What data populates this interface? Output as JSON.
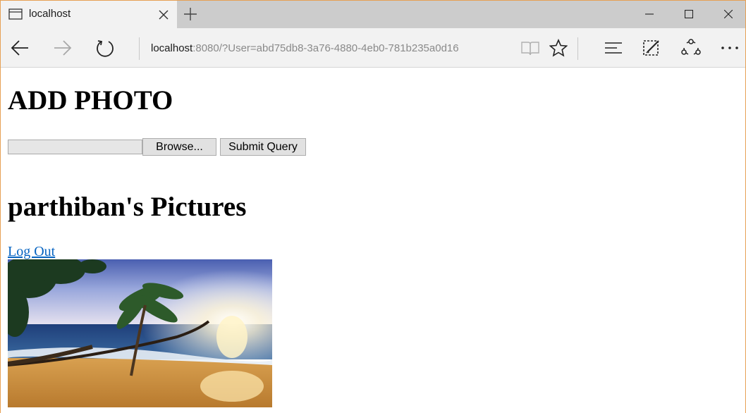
{
  "browser": {
    "tab_title": "localhost",
    "address_host": "localhost",
    "address_rest": ":8080/?User=abd75db8-3a76-4880-4eb0-781b235a0d16"
  },
  "page": {
    "add_heading": "ADD PHOTO",
    "browse_label": "Browse...",
    "submit_label": "Submit Query",
    "pictures_heading": "parthiban's Pictures",
    "logout_label": "Log Out"
  },
  "colors": {
    "link": "#0563c1",
    "chrome_bg": "#f2f2f2",
    "tabstrip_bg": "#cccccc",
    "window_border": "#e6a054"
  },
  "icons": [
    "tab-page-icon",
    "close-icon",
    "plus-icon",
    "minimize-icon",
    "maximize-icon",
    "window-close-icon",
    "back-arrow-icon",
    "forward-arrow-icon",
    "refresh-icon",
    "reading-view-icon",
    "star-icon",
    "hub-icon",
    "web-note-icon",
    "share-icon",
    "more-icon"
  ]
}
